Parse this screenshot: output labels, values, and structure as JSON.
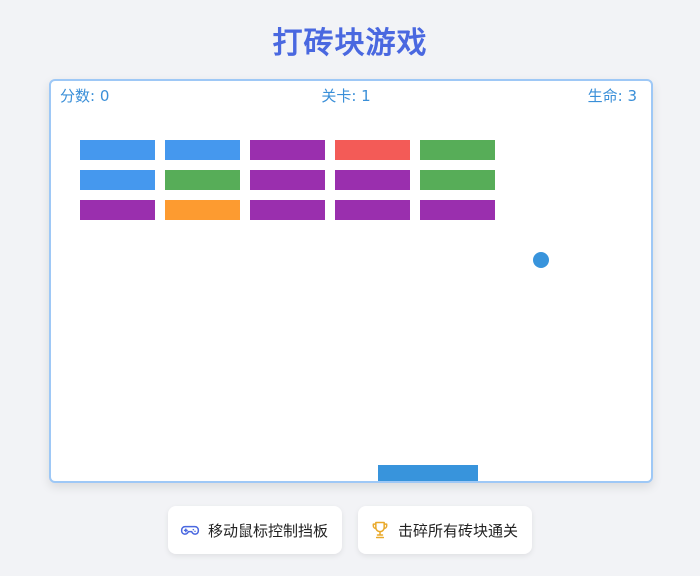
{
  "title": "打砖块游戏",
  "hud": {
    "score_label": "分数: 0",
    "level_label": "关卡: 1",
    "lives_label": "生命: 3"
  },
  "bricks": {
    "rows": [
      [
        "blue",
        "blue",
        "purple",
        "red",
        "green"
      ],
      [
        "blue",
        "green",
        "purple",
        "purple",
        "green"
      ],
      [
        "purple",
        "orange",
        "purple",
        "purple",
        "purple"
      ]
    ]
  },
  "colors": {
    "blue": "#4598ee",
    "purple": "#9a2fae",
    "red": "#f35b57",
    "green": "#57ad58",
    "orange": "#fd9b30",
    "accent": "#4a68e0",
    "ball": "#3894dc",
    "paddle": "#3894dc",
    "gamepad_icon": "#4a68e0",
    "trophy_icon": "#e9a92a"
  },
  "tips": [
    {
      "icon": "gamepad-icon",
      "label": "移动鼠标控制挡板"
    },
    {
      "icon": "trophy-icon",
      "label": "击碎所有砖块通关"
    }
  ]
}
